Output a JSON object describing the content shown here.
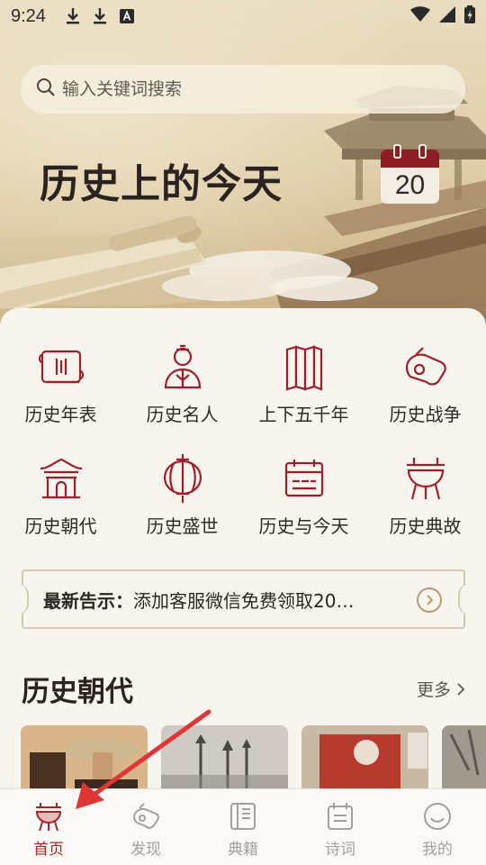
{
  "status_bar": {
    "time": "9:24"
  },
  "search": {
    "placeholder": "输入关键词搜索"
  },
  "hero": {
    "title": "历史上的今天",
    "calendar_day": "20"
  },
  "grid": [
    {
      "label": "历史年表",
      "icon": "scroll-icon"
    },
    {
      "label": "历史名人",
      "icon": "scholar-icon"
    },
    {
      "label": "上下五千年",
      "icon": "bamboo-slips-icon"
    },
    {
      "label": "历史战争",
      "icon": "helmet-icon"
    },
    {
      "label": "历史朝代",
      "icon": "palace-icon"
    },
    {
      "label": "历史盛世",
      "icon": "lantern-icon"
    },
    {
      "label": "历史与今天",
      "icon": "calendar-icon"
    },
    {
      "label": "历史典故",
      "icon": "ding-cauldron-icon"
    }
  ],
  "notice": {
    "title": "最新告示：",
    "text": "添加客服微信免费领取20…"
  },
  "section": {
    "title": "历史朝代",
    "more": "更多"
  },
  "tabbar": [
    {
      "label": "首页",
      "icon": "ding-cauldron-icon",
      "active": true
    },
    {
      "label": "发现",
      "icon": "helmet-icon",
      "active": false
    },
    {
      "label": "典籍",
      "icon": "book-icon",
      "active": false
    },
    {
      "label": "诗词",
      "icon": "poem-icon",
      "active": false
    },
    {
      "label": "我的",
      "icon": "smile-icon",
      "active": false
    }
  ],
  "colors": {
    "accent": "#a4262c",
    "icon_red": "#9e1f2b",
    "background": "#f8f4ee"
  }
}
